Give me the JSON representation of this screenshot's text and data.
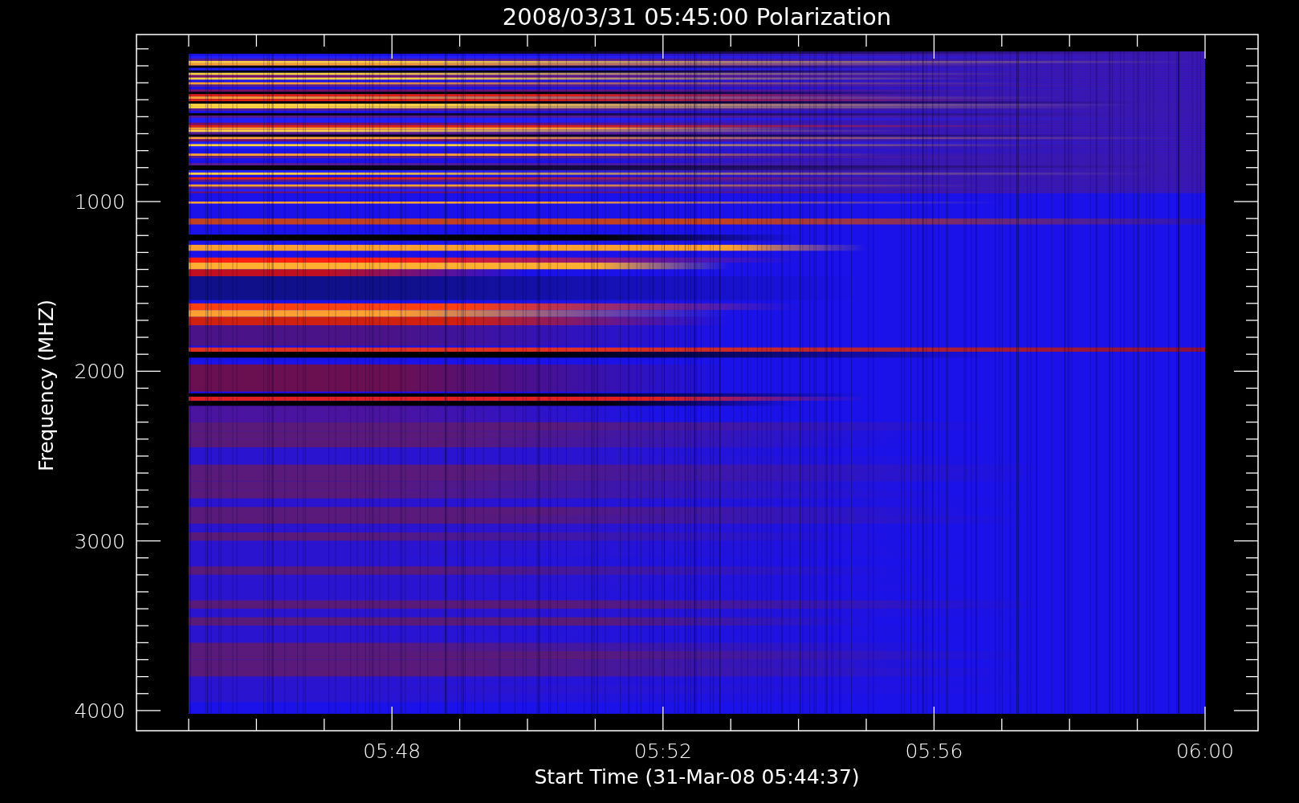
{
  "plot": {
    "title": "2008/03/31 05:45:00 Polarization",
    "ylabel": "Frequency (MHZ)",
    "xlabel": "Start Time (31-Mar-08 05:44:37)",
    "y_tick_labels": [
      "1000",
      "2000",
      "3000",
      "4000"
    ],
    "x_tick_labels": [
      "05:48",
      "05:52",
      "05:56",
      "06:00"
    ]
  }
}
